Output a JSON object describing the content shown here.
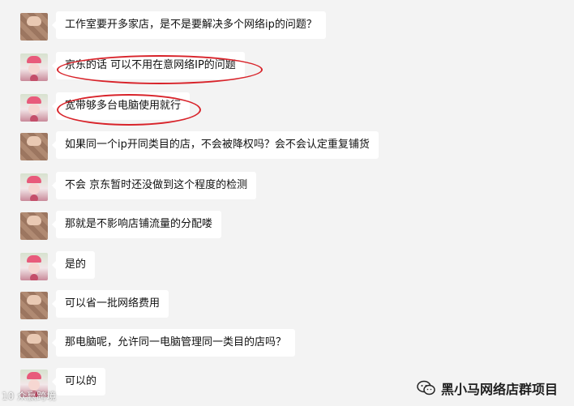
{
  "messages": [
    {
      "text": "工作室要开多家店，是不是要解决多个网络ip的问题？",
      "avatar": "user-a"
    },
    {
      "text": "京东的话  可以不用在意网络IP的问题",
      "avatar": "user-b",
      "highlight": true
    },
    {
      "text": "宽带够多台电脑使用就行",
      "avatar": "user-b",
      "highlight": true
    },
    {
      "text": "如果同一个ip开同类目的店，不会被降权吗？会不会认定重复铺货",
      "avatar": "user-a"
    },
    {
      "text": "不会   京东暂时还没做到这个程度的检测",
      "avatar": "user-b"
    },
    {
      "text": "那就是不影响店铺流量的分配喽",
      "avatar": "user-a"
    },
    {
      "text": "是的",
      "avatar": "user-b"
    },
    {
      "text": "可以省一批网络费用",
      "avatar": "user-a"
    },
    {
      "text": "那电脑呢，允许同一电脑管理同一类目的店吗？",
      "avatar": "user-a"
    },
    {
      "text": "可以的",
      "avatar": "user-b"
    }
  ],
  "footer": {
    "watermark_left": "10 众赢跨境",
    "brand": "黑小马网络店群项目",
    "brand_icon": "wechat-icon"
  },
  "colors": {
    "highlight": "#d8232a",
    "background": "#f3f3f3",
    "bubble": "#ffffff"
  }
}
